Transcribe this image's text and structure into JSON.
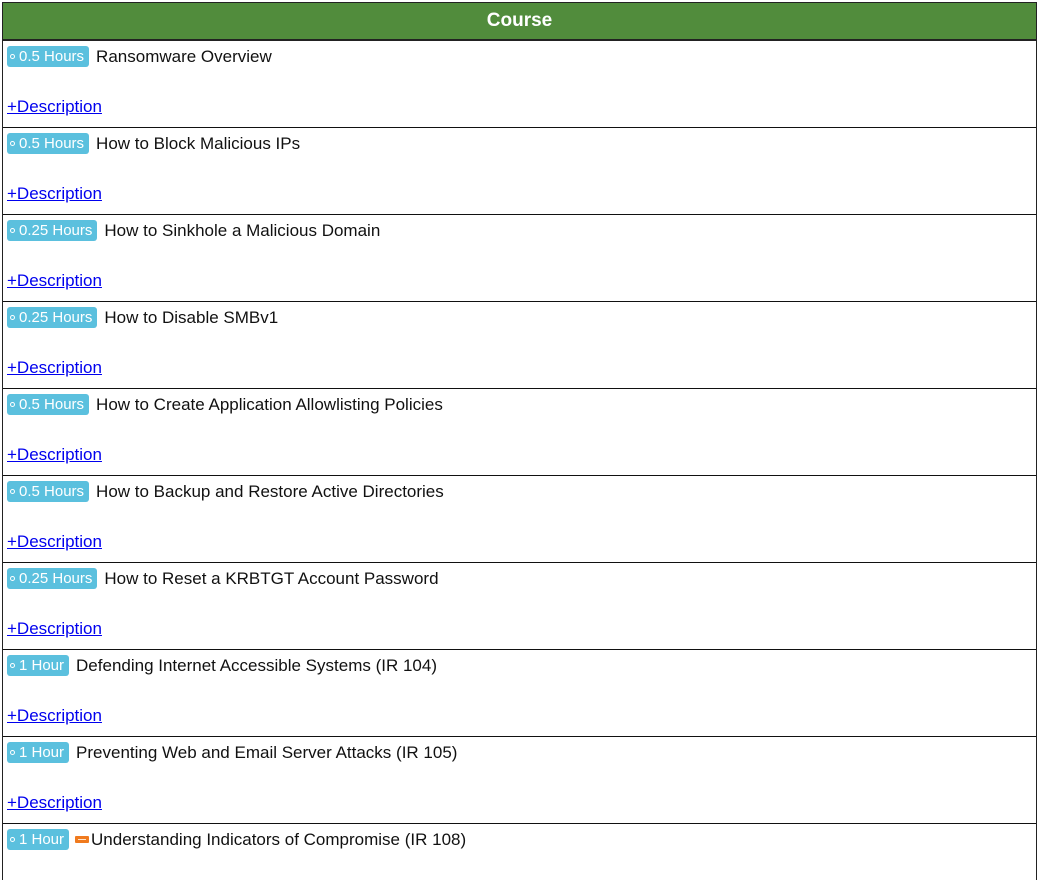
{
  "table": {
    "header": "Course",
    "description_label": "+Description",
    "colors": {
      "header_bg": "#518c3c",
      "badge_bg": "#5bc0de",
      "link": "#0000ee",
      "new_icon": "#f07a1e"
    },
    "rows": [
      {
        "duration": "0.5 Hours",
        "title": "Ransomware Overview",
        "new": false
      },
      {
        "duration": "0.5 Hours",
        "title": "How to Block Malicious IPs",
        "new": false
      },
      {
        "duration": "0.25 Hours",
        "title": "How to Sinkhole a Malicious Domain",
        "new": false
      },
      {
        "duration": "0.25 Hours",
        "title": "How to Disable SMBv1",
        "new": false
      },
      {
        "duration": "0.5 Hours",
        "title": "How to Create Application Allowlisting Policies",
        "new": false
      },
      {
        "duration": "0.5 Hours",
        "title": "How to Backup and Restore Active Directories",
        "new": false
      },
      {
        "duration": "0.25 Hours",
        "title": "How to Reset a KRBTGT Account Password",
        "new": false
      },
      {
        "duration": "1 Hour",
        "title": "Defending Internet Accessible Systems (IR 104)",
        "new": false
      },
      {
        "duration": "1 Hour",
        "title": "Preventing Web and Email Server Attacks (IR 105)",
        "new": false
      },
      {
        "duration": "1 Hour",
        "title": "Understanding Indicators of Compromise (IR 108)",
        "new": true
      }
    ]
  }
}
